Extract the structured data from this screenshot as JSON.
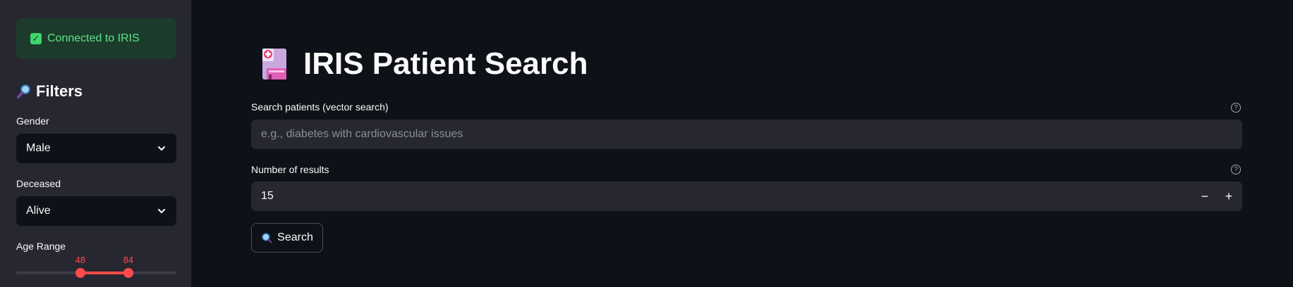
{
  "sidebar": {
    "status": "Connected to IRIS",
    "filters_title": "Filters",
    "gender": {
      "label": "Gender",
      "value": "Male"
    },
    "deceased": {
      "label": "Deceased",
      "value": "Alive"
    },
    "age_range": {
      "label": "Age Range",
      "low": "48",
      "high": "84",
      "low_value": 48,
      "high_value": 84,
      "min": 0,
      "max": 120
    }
  },
  "main": {
    "title": "IRIS Patient Search",
    "search": {
      "label": "Search patients (vector search)",
      "placeholder": "e.g., diabetes with cardiovascular issues",
      "help": "?"
    },
    "results": {
      "label": "Number of results",
      "value": "15",
      "help": "?",
      "minus": "−",
      "plus": "+"
    },
    "search_button": "Search"
  },
  "colors": {
    "accent": "#ff4b4b",
    "success": "#3dd56d",
    "background": "#0e1117",
    "sidebar": "#262730"
  },
  "icons": [
    "check-icon",
    "magnifier-icon",
    "chevron-down-icon",
    "hospital-icon",
    "help-icon",
    "search-icon"
  ]
}
